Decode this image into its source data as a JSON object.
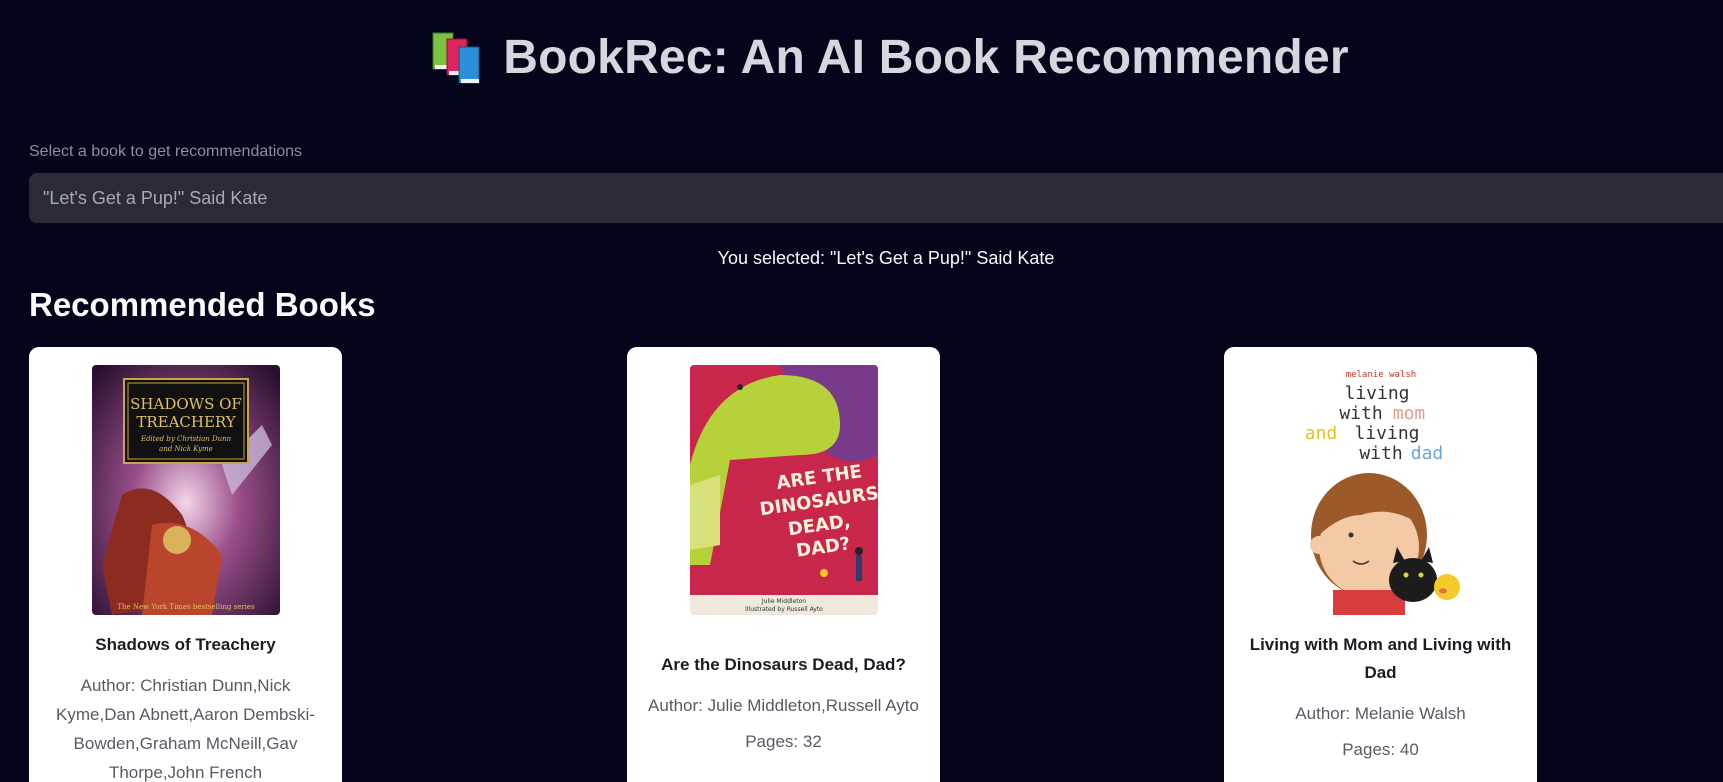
{
  "header": {
    "title": "BookRec: An AI Book Recommender",
    "icon": "books-icon"
  },
  "selector": {
    "label": "Select a book to get recommendations",
    "value": "\"Let's Get a Pup!\" Said Kate"
  },
  "selected_text": "You selected: \"Let's Get a Pup!\" Said Kate",
  "section_heading": "Recommended Books",
  "books": [
    {
      "title": "Shadows of Treachery",
      "author": "Author: Christian Dunn,Nick Kyme,Dan Abnett,Aaron Dembski-Bowden,Graham McNeill,Gav Thorpe,John French",
      "pages": "",
      "cover_text": {
        "title_line1": "SHADOWS OF",
        "title_line2": "TREACHERY",
        "edited_by": "Edited by Christian Dunn",
        "edited_by2": "and Nick Kyme",
        "banner": "The New York Times bestselling series"
      }
    },
    {
      "title": "Are the Dinosaurs Dead, Dad?",
      "author": "Author: Julie Middleton,Russell Ayto",
      "pages": "Pages: 32",
      "cover_text": {
        "line1": "ARE THE",
        "line2": "DINOSAURS",
        "line3": "DEAD,",
        "line4": "DAD?",
        "credit1": "Julie Middleton",
        "credit2": "Illustrated by Russell Ayto"
      }
    },
    {
      "title": "Living with Mom and Living with Dad",
      "author": "Author: Melanie Walsh",
      "pages": "Pages: 40",
      "cover_text": {
        "author": "melanie walsh",
        "line1": "living",
        "line2a": "with",
        "line2b": "mom",
        "line3a": "and",
        "line3b": "living",
        "line4a": "with",
        "line4b": "dad"
      }
    }
  ]
}
